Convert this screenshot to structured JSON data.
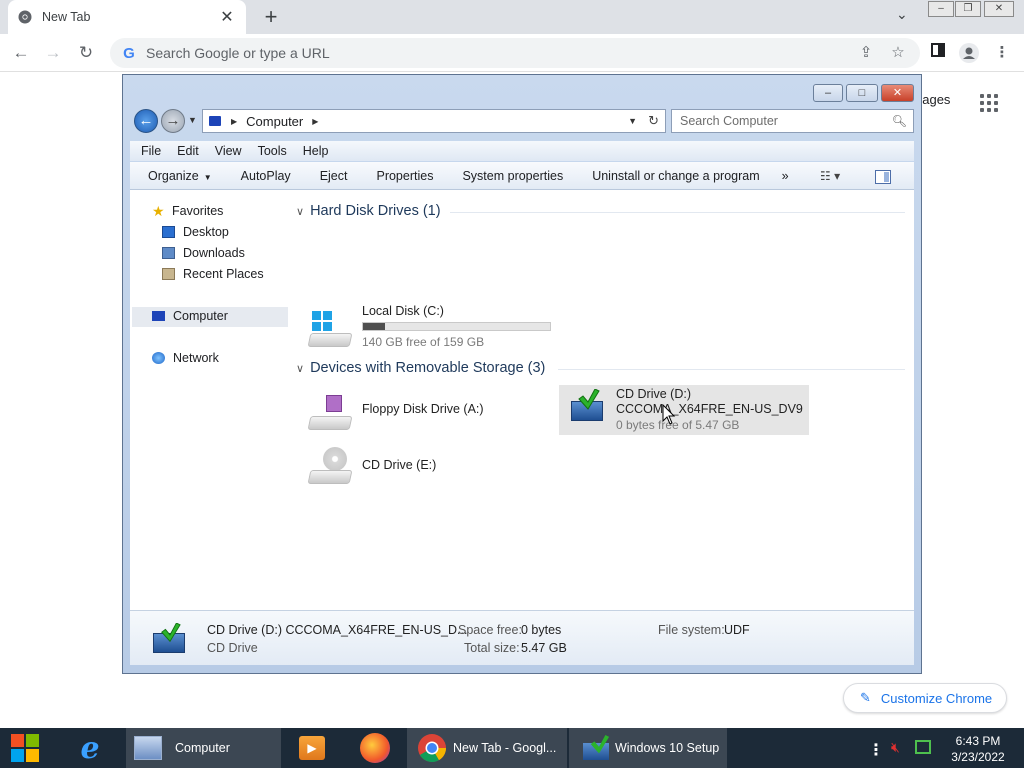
{
  "chrome": {
    "tab_title": "New Tab",
    "omnibox_placeholder": "Search Google or type a URL",
    "images_link_partial": "nages",
    "customize_label": "Customize Chrome"
  },
  "explorer": {
    "address": "Computer",
    "search_placeholder": "Search Computer",
    "menu": [
      "File",
      "Edit",
      "View",
      "Tools",
      "Help"
    ],
    "commands": [
      "Organize",
      "AutoPlay",
      "Eject",
      "Properties",
      "System properties",
      "Uninstall or change a program",
      "»"
    ],
    "nav": {
      "favorites": "Favorites",
      "desktop": "Desktop",
      "downloads": "Downloads",
      "recent": "Recent Places",
      "computer": "Computer",
      "network": "Network"
    },
    "groups": {
      "hard_disks": "Hard Disk Drives (1)",
      "removable": "Devices with Removable Storage (3)"
    },
    "drives": {
      "c_label": "Local Disk (C:)",
      "c_free": "140 GB free of 159 GB",
      "c_used_fraction": 0.12,
      "a_label": "Floppy Disk Drive (A:)",
      "d_label": "CD Drive (D:)",
      "d_volume": "CCCOMA_X64FRE_EN-US_DV9",
      "d_free": "0 bytes free of 5.47 GB",
      "e_label": "CD Drive (E:)"
    },
    "details": {
      "title": "CD Drive (D:) CCCOMA_X64FRE_EN-US_D...",
      "type": "CD Drive",
      "space_free_label": "Space free:",
      "space_free": "0 bytes",
      "total_size_label": "Total size:",
      "total_size": "5.47 GB",
      "fs_label": "File system:",
      "fs": "UDF"
    }
  },
  "taskbar": {
    "computer": "Computer",
    "chrome": "New Tab - Googl...",
    "setup": "Windows 10 Setup",
    "time": "6:43 PM",
    "date": "3/23/2022"
  }
}
